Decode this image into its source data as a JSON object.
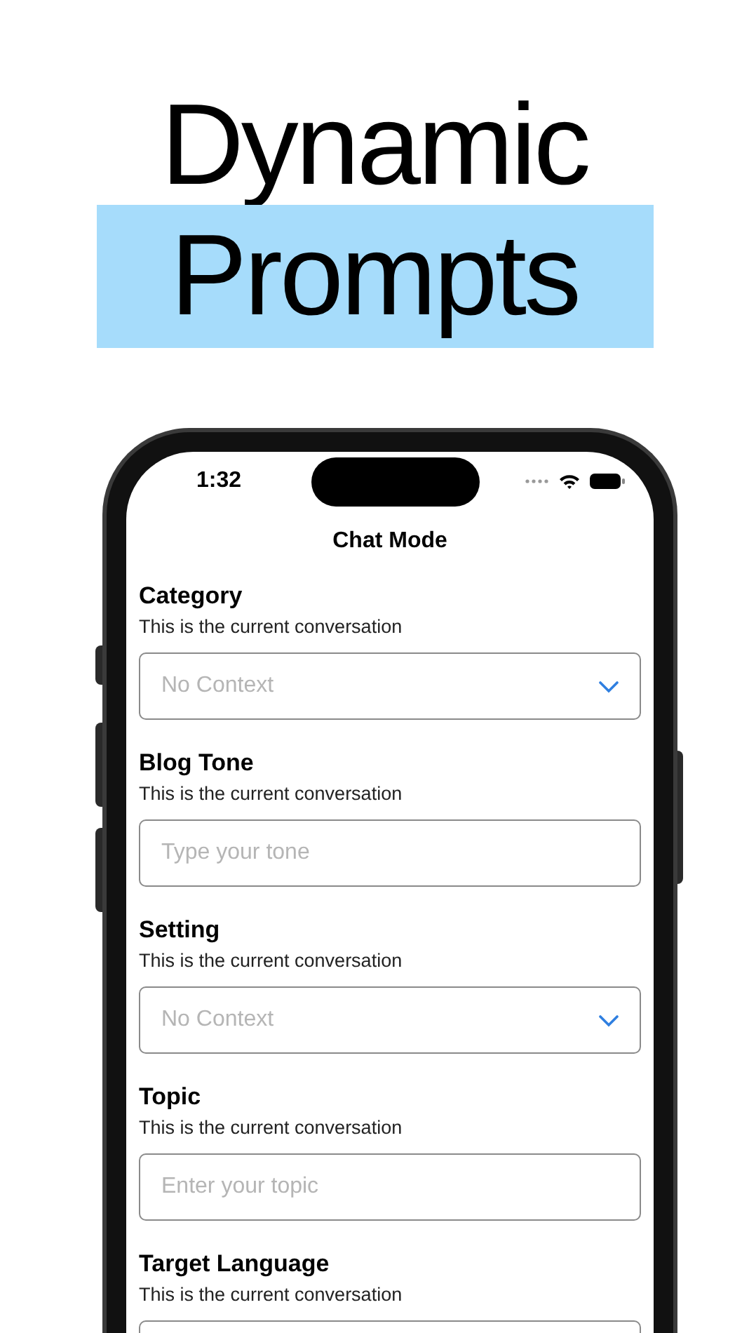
{
  "headline": {
    "line_1": "Dynamic",
    "line_2": "Prompts"
  },
  "status_bar": {
    "time": "1:32"
  },
  "screen": {
    "title": "Chat Mode"
  },
  "fields": [
    {
      "label": "Category",
      "description": "This is the current conversation",
      "kind": "select",
      "placeholder": "No Context"
    },
    {
      "label": "Blog Tone",
      "description": "This is the current conversation",
      "kind": "text",
      "placeholder": "Type your tone"
    },
    {
      "label": "Setting",
      "description": "This is the current conversation",
      "kind": "select",
      "placeholder": "No Context"
    },
    {
      "label": "Topic",
      "description": "This is the current conversation",
      "kind": "text",
      "placeholder": "Enter your topic"
    },
    {
      "label": "Target Language",
      "description": "This is the current conversation",
      "kind": "text"
    }
  ]
}
